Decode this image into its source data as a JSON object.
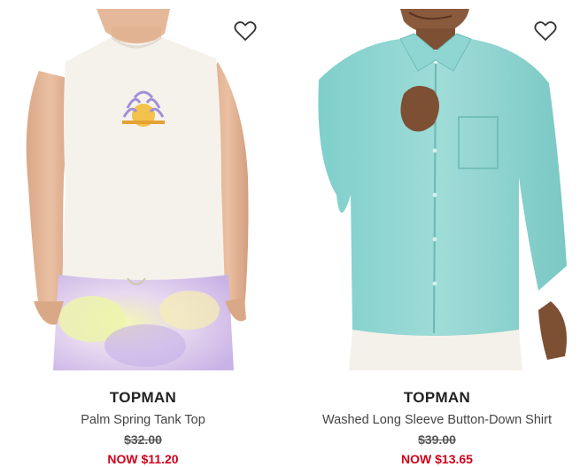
{
  "products": [
    {
      "brand": "TOPMAN",
      "name": "Palm Spring Tank Top",
      "original_price": "$32.00",
      "sale_price": "NOW $11.20",
      "wishlist_icon": "heart-outline-icon"
    },
    {
      "brand": "TOPMAN",
      "name": "Washed Long Sleeve Button-Down Shirt",
      "original_price": "$39.00",
      "sale_price": "NOW $13.65",
      "wishlist_icon": "heart-outline-icon"
    }
  ],
  "colors": {
    "sale_red": "#d0021b",
    "shirt_teal": "#8fd3d0",
    "tank_white": "#f4f1ea"
  }
}
